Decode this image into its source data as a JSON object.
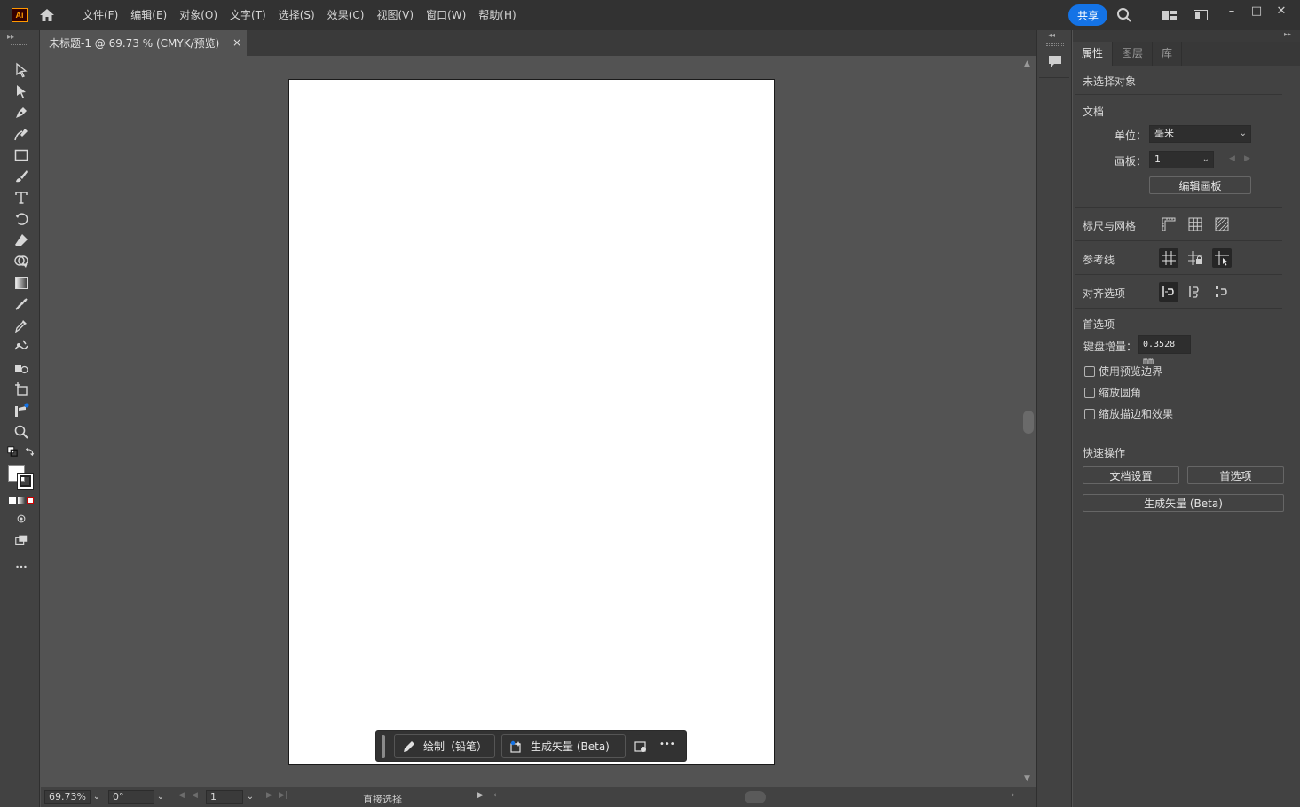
{
  "app": {
    "logo_text": "Ai",
    "menus": [
      "文件(F)",
      "编辑(E)",
      "对象(O)",
      "文字(T)",
      "选择(S)",
      "效果(C)",
      "视图(V)",
      "窗口(W)",
      "帮助(H)"
    ],
    "share_label": "共享",
    "window_controls": {
      "minimize": "–",
      "maximize": "□",
      "close": "✕"
    }
  },
  "document": {
    "tab_title": "未标题-1 @ 69.73 % (CMYK/预览)",
    "close_glyph": "×"
  },
  "context_bar": {
    "draw_label": "绘制（铅笔）",
    "generate_label": "生成矢量 (Beta)",
    "more_glyph": "•••"
  },
  "status": {
    "zoom": "69.73%",
    "rotation": "0°",
    "artboard": "1",
    "tool_name": "直接选择"
  },
  "properties": {
    "tabs": [
      "属性",
      "图层",
      "库"
    ],
    "no_selection": "未选择对象",
    "doc_section": "文档",
    "unit_label": "单位：",
    "unit_value": "毫米",
    "artboard_label": "画板：",
    "artboard_value": "1",
    "edit_artboard_btn": "编辑画板",
    "rulers_grids": "标尺与网格",
    "guides": "参考线",
    "snap_options": "对齐选项",
    "preferences": "首选项",
    "keyboard_increment_label": "键盘增量：",
    "keyboard_increment_value": "0.3528 mm",
    "checkboxes": [
      "使用预览边界",
      "缩放圆角",
      "缩放描边和效果"
    ],
    "quick_actions": "快速操作",
    "doc_setup_btn": "文档设置",
    "prefs_btn": "首选项",
    "generate_vector_btn": "生成矢量 (Beta)"
  },
  "colors": {
    "accent": "#1473e6",
    "canvas_bg": "#535353",
    "panel_bg": "#424242",
    "artboard": "#ffffff"
  },
  "icons": {
    "tools": [
      "selection-tool-icon",
      "direct-selection-tool-icon",
      "pen-tool-icon",
      "curvature-tool-icon",
      "rectangle-tool-icon",
      "paintbrush-tool-icon",
      "type-tool-icon",
      "rotate-tool-icon",
      "eraser-tool-icon",
      "shape-builder-tool-icon",
      "gradient-tool-icon",
      "blend-tool-icon",
      "eyedropper-tool-icon",
      "puppet-warp-tool-icon",
      "symbol-sprayer-tool-icon",
      "artboard-tool-icon",
      "graph-tool-icon",
      "zoom-tool-icon"
    ]
  }
}
